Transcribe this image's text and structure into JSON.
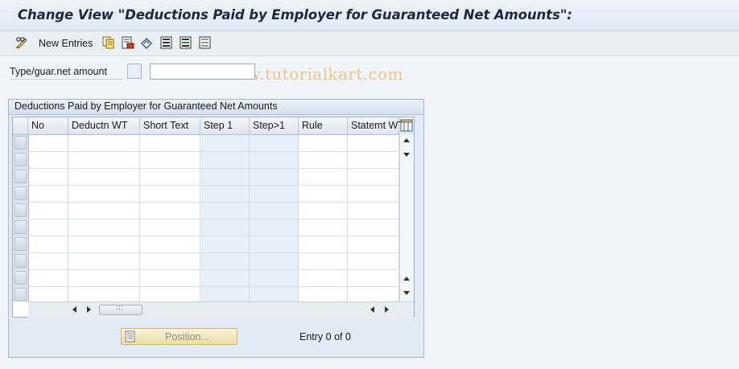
{
  "title": "Change View \"Deductions Paid by Employer for Guaranteed Net Amounts\":",
  "watermark": "www.tutorialkart.com",
  "toolbar": {
    "items": [
      {
        "icon": "pencil-glasses-icon"
      },
      {
        "label": "New Entries"
      },
      {
        "icon": "copy-icon"
      },
      {
        "icon": "delete-icon"
      },
      {
        "icon": "undo-icon"
      },
      {
        "icon": "select-all-icon"
      },
      {
        "icon": "select-block-icon"
      },
      {
        "icon": "deselect-all-icon"
      }
    ]
  },
  "filter": {
    "label": "Type/guar.net amount",
    "value": ""
  },
  "group": {
    "title": "Deductions Paid by Employer for Guaranteed Net Amounts"
  },
  "table": {
    "columns": [
      "No",
      "Deductn WT",
      "Short Text",
      "Step 1",
      "Step>1",
      "Rule",
      "Statemt WT"
    ],
    "row_count": 10,
    "settings_icon": "table-settings-icon"
  },
  "footer": {
    "position_label": "Position...",
    "entry_text": "Entry 0 of 0"
  },
  "colors": {
    "title_bar": "#dfe8f2",
    "shaded_columns": "#e6eef6",
    "position_button": "#f3e6bd"
  }
}
